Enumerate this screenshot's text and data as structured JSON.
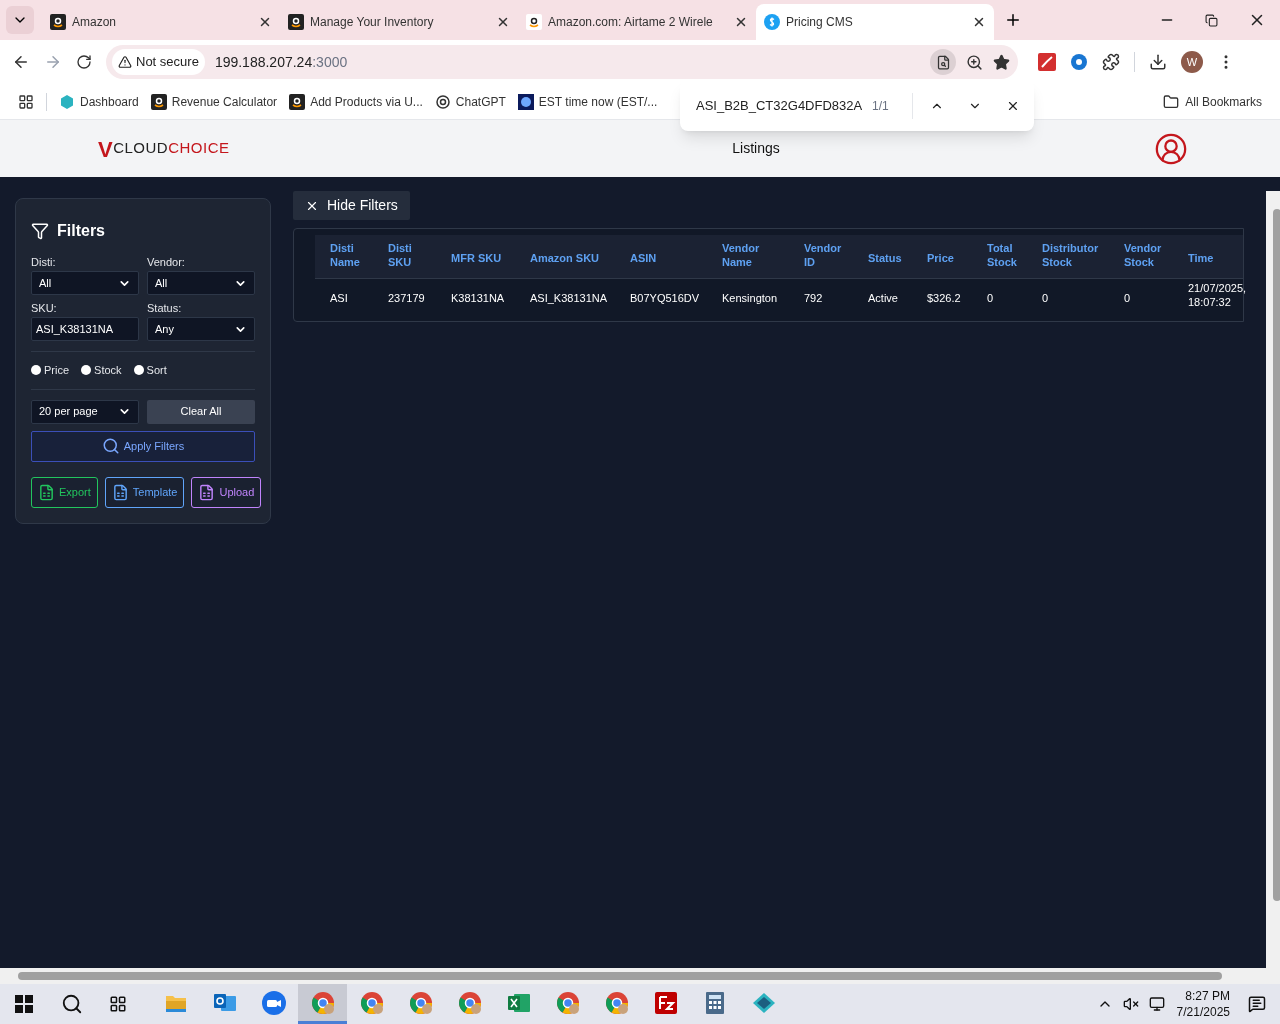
{
  "browser": {
    "tabs": [
      {
        "title": "Amazon",
        "kind": "amazon",
        "selected": false
      },
      {
        "title": "Manage Your Inventory",
        "kind": "amazon",
        "selected": false
      },
      {
        "title": "Amazon.com: Airtame 2 Wirele",
        "kind": "smile",
        "selected": false
      },
      {
        "title": "Pricing CMS",
        "kind": "dollar",
        "selected": true
      }
    ],
    "address": {
      "security": "Not secure",
      "host": "199.188.207.24",
      "port": ":3000"
    },
    "bookmarks": [
      {
        "label": "Dashboard",
        "kind": "hex"
      },
      {
        "label": "Revenue Calculator",
        "kind": "amazon"
      },
      {
        "label": "Add Products via U...",
        "kind": "amazon"
      },
      {
        "label": "ChatGPT",
        "kind": "knot"
      },
      {
        "label": "EST time now (EST/...",
        "kind": "globe"
      }
    ],
    "all_bookmarks": "All Bookmarks",
    "profile_initial": "W",
    "find_bar": {
      "query": "ASI_B2B_CT32G4DFD832A",
      "count": "1/1"
    }
  },
  "app": {
    "logo": [
      {
        "text": "V",
        "kind": "accent"
      },
      {
        "text": "CLOUD",
        "kind": "plain"
      },
      {
        "text": "CHOICE",
        "kind": "accent"
      }
    ],
    "nav": "Listings",
    "hide_filters": "Hide Filters",
    "filters": {
      "title": "Filters",
      "fields": [
        {
          "label": "Disti:",
          "kind": "select",
          "value": "All"
        },
        {
          "label": "Vendor:",
          "kind": "select",
          "value": "All"
        },
        {
          "label": "SKU:",
          "kind": "input",
          "value": "ASI_K38131NA"
        },
        {
          "label": "Status:",
          "kind": "select",
          "value": "Any"
        }
      ],
      "radios": [
        {
          "label": "Price",
          "checked": false
        },
        {
          "label": "Stock",
          "checked": false
        },
        {
          "label": "Sort",
          "checked": false
        }
      ],
      "per_page": "20 per page",
      "clear": "Clear All",
      "apply": "Apply Filters",
      "actions": [
        {
          "label": "Export",
          "color": "#22c55e"
        },
        {
          "label": "Template",
          "color": "#60a5fa"
        },
        {
          "label": "Upload",
          "color": "#c084fc"
        }
      ]
    },
    "table": {
      "columns": [
        "Disti Name",
        "Disti SKU",
        "MFR SKU",
        "Amazon SKU",
        "ASIN",
        "Vendor Name",
        "Vendor ID",
        "Status",
        "Price",
        "Total Stock",
        "Distributor Stock",
        "Vendor Stock",
        "Time"
      ],
      "rows": [
        [
          "ASI",
          "237179",
          "K38131NA",
          "ASI_K38131NA",
          "B07YQ516DV",
          "Kensington",
          "792",
          "Active",
          "$326.2",
          "0",
          "0",
          "0",
          "21/07/2025, 18:07:32"
        ]
      ]
    }
  },
  "taskbar": {
    "apps": [
      {
        "kind": "folder",
        "selected": false
      },
      {
        "kind": "mail",
        "selected": false
      },
      {
        "kind": "video",
        "selected": false
      },
      {
        "kind": "browser",
        "selected": true
      },
      {
        "kind": "browser",
        "selected": false
      },
      {
        "kind": "browser",
        "selected": false
      },
      {
        "kind": "browser",
        "selected": false
      },
      {
        "kind": "sheet",
        "selected": false
      },
      {
        "kind": "browser",
        "selected": false
      },
      {
        "kind": "browser",
        "selected": false
      },
      {
        "kind": "ftp",
        "selected": false
      },
      {
        "kind": "calc",
        "selected": false
      },
      {
        "kind": "diamond",
        "selected": false
      }
    ],
    "time": "8:27 PM",
    "date": "7/21/2025"
  }
}
